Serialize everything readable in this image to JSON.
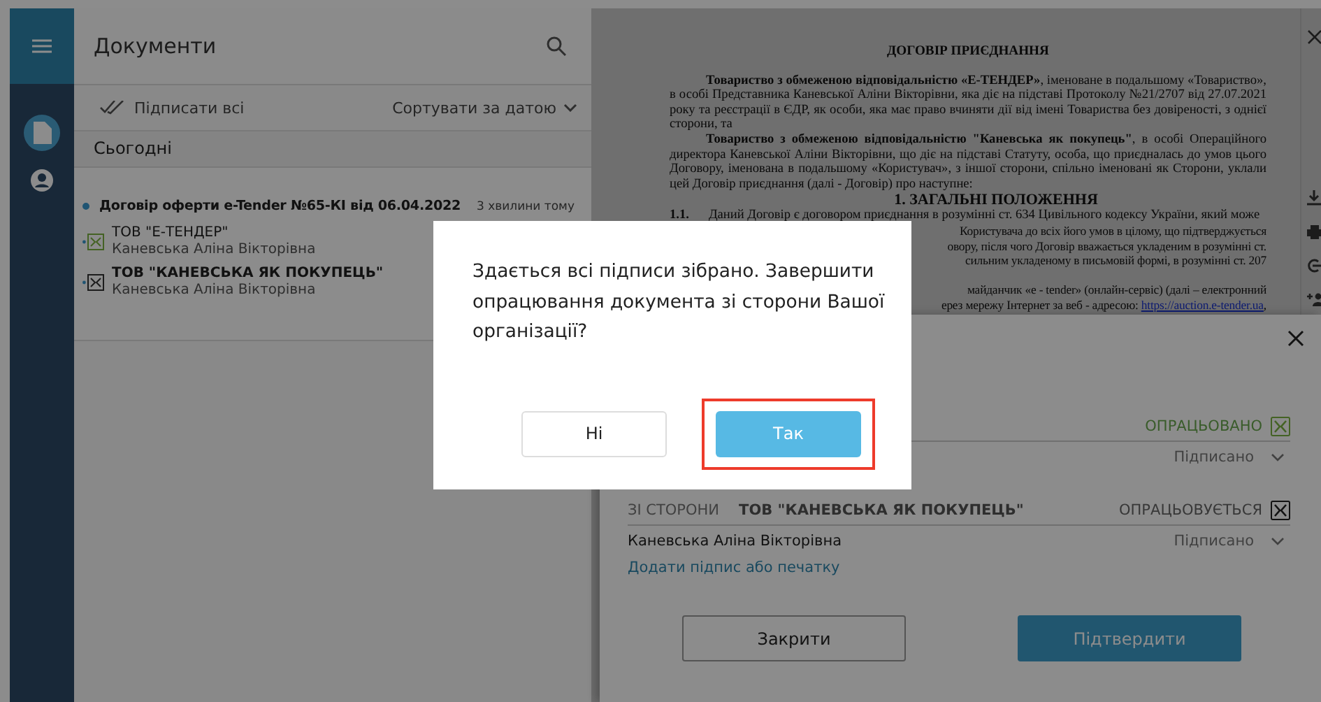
{
  "sidebar": {
    "items": [
      {
        "kind": "document",
        "selected": true
      },
      {
        "kind": "account",
        "selected": false
      }
    ]
  },
  "documents_panel": {
    "title": "Документи",
    "sign_all": "Підписати всі",
    "sort": "Сортувати за датою",
    "group": "Сьогодні",
    "items": [
      {
        "title": "Договір оферти e-Tender №65-КІ від 06.04.2022",
        "time": "3 хвилини тому",
        "unread": true,
        "parties": [
          {
            "org": "ТОВ \"Е-ТЕНДЕР\"",
            "person": "Каневська Аліна Вікторівна",
            "done": true
          },
          {
            "org": "ТОВ \"КАНЕВСЬКА ЯК ПОКУПЕЦЬ\"",
            "person": "Каневська Аліна Вікторівна",
            "done": false
          }
        ]
      }
    ]
  },
  "document": {
    "heading": "ДОГОВІР ПРИЄДНАННЯ",
    "paragraphs": [
      "**Товариство з обмеженою відповідальністю «Е-ТЕНДЕР»**, іменоване в подальшому «Товариство», в особі Представника Каневської Аліни Вікторівни, яка діє на підставі Протоколу №21/2707 від 27.07.2021 року та реєстрації в ЄДР, як особи, яка має право вчиняти дії від імені Товариства без довіреності, з однієї сторони, та",
      "**Товариство з обмеженою відповідальністю \"Каневська як покупець\"**, в особі Операційного директора Каневської Аліни Вікторівни, що діє на підставі Статуту, особа, що приєдналась до умов цього Договору, іменована в подальшому «Користувач», з іншої сторони, спільно іменовані як Сторони, уклали цей Договір приєднання (далі - Договір) про наступне:"
    ],
    "section": "1.   ЗАГАЛЬНІ ПОЛОЖЕННЯ",
    "clause": {
      "number": "1.1.",
      "text": "Даний Договір є договором приєднання в розумінні ст. 634 Цивільного кодексу України, який може"
    },
    "fragments": [
      {
        "text": "Користувача до всіх його умов в цілому, що підтверджується"
      },
      {
        "text": "овору, після чого Договір вважається укладеним в розумінні ст."
      },
      {
        "text": "сильним укладеному в письмовій формі, в розумінні ст. 207"
      },
      {
        "text": "майданчик «е - tender» (онлайн-сервіс) (далі – електронний",
        "gap_before": true
      },
      {
        "text": "ерез мережу Інтернет за веб - адресою: ",
        "link": "https://auction.e-tender.ua",
        "after": ","
      }
    ]
  },
  "sign_panel": {
    "parties": [
      {
        "status": "ОПРАЦЬОВАНО",
        "done": true,
        "signers": [
          {
            "status": "Підписано"
          }
        ]
      },
      {
        "side_label": "ЗІ СТОРОНИ",
        "org": "ТОВ \"КАНЕВСЬКА ЯК ПОКУПЕЦЬ\"",
        "status": "ОПРАЦЬОВУЄТЬСЯ",
        "done": false,
        "signers": [
          {
            "name": "Каневська Аліна Вікторівна",
            "status": "Підписано"
          }
        ]
      }
    ],
    "add_link": "Додати підпис або печатку",
    "buttons": [
      {
        "label": "Закрити",
        "kind": "secondary"
      },
      {
        "label": "Підтвердити",
        "kind": "primary"
      }
    ]
  },
  "dialog": {
    "message": "Здається всі підписи зібрано. Завершити опрацювання документа зі сторони Вашої організації?",
    "buttons": [
      {
        "label": "Ні",
        "kind": "secondary",
        "highlighted": false
      },
      {
        "label": "Так",
        "kind": "primary",
        "highlighted": true
      }
    ]
  }
}
